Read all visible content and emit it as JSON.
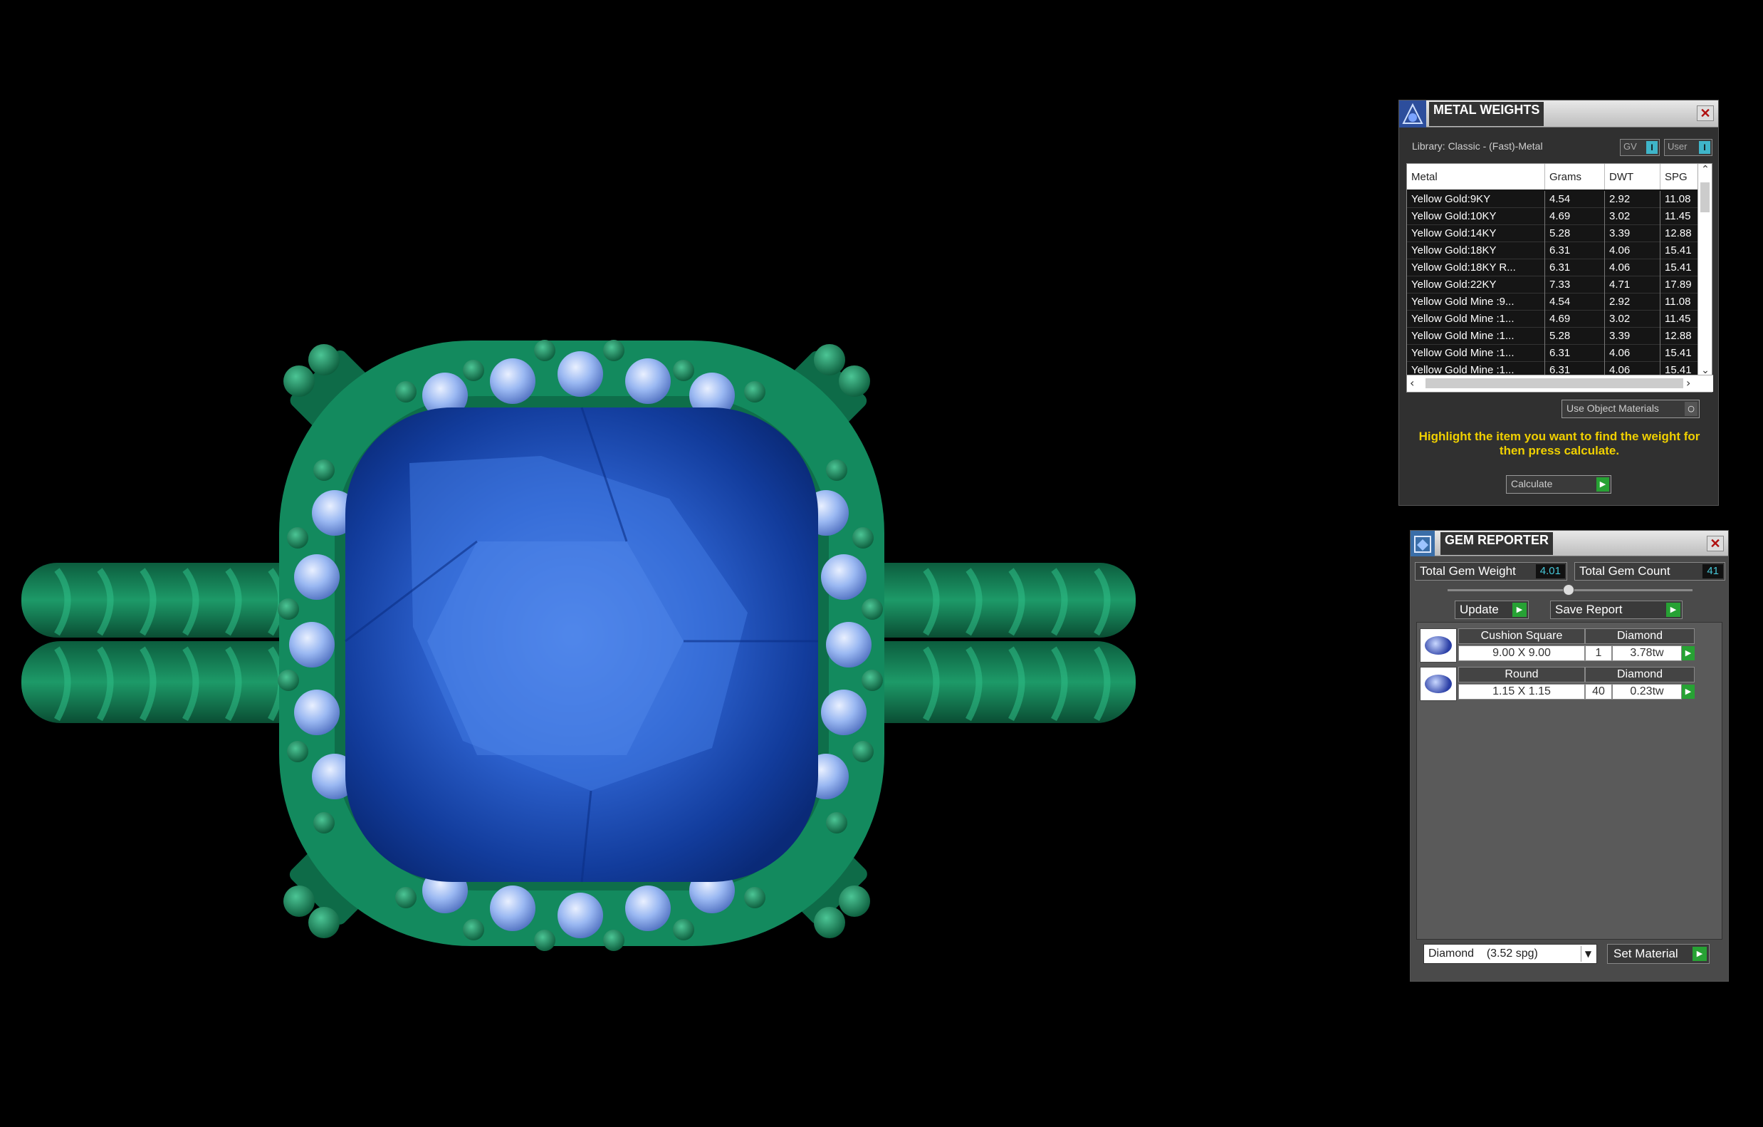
{
  "metal_weights": {
    "title": "METAL WEIGHTS",
    "library": "Library: Classic - (Fast)-Metal",
    "toggle_gv": "GV",
    "toggle_user": "User",
    "toggle_state": "I",
    "columns": [
      "Metal",
      "Grams",
      "DWT",
      "SPG"
    ],
    "rows": [
      [
        "Yellow Gold:9KY",
        "4.54",
        "2.92",
        "11.08"
      ],
      [
        "Yellow Gold:10KY",
        "4.69",
        "3.02",
        "11.45"
      ],
      [
        "Yellow Gold:14KY",
        "5.28",
        "3.39",
        "12.88"
      ],
      [
        "Yellow Gold:18KY",
        "6.31",
        "4.06",
        "15.41"
      ],
      [
        "Yellow Gold:18KY R...",
        "6.31",
        "4.06",
        "15.41"
      ],
      [
        "Yellow Gold:22KY",
        "7.33",
        "4.71",
        "17.89"
      ],
      [
        "Yellow Gold Mine :9...",
        "4.54",
        "2.92",
        "11.08"
      ],
      [
        "Yellow Gold Mine :1...",
        "4.69",
        "3.02",
        "11.45"
      ],
      [
        "Yellow Gold Mine :1...",
        "5.28",
        "3.39",
        "12.88"
      ],
      [
        "Yellow Gold Mine :1...",
        "6.31",
        "4.06",
        "15.41"
      ],
      [
        "Yellow Gold Mine :1...",
        "6.31",
        "4.06",
        "15.41"
      ]
    ],
    "use_object_materials": "Use Object Materials",
    "info": "Highlight the item you want to find the weight for then press calculate.",
    "calculate": "Calculate"
  },
  "gem_reporter": {
    "title": "GEM REPORTER",
    "total_weight_label": "Total Gem Weight",
    "total_weight": "4.01",
    "total_count_label": "Total Gem Count",
    "total_count": "41",
    "update": "Update",
    "save_report": "Save Report",
    "gems": [
      {
        "shape": "Cushion Square",
        "material": "Diamond",
        "size": "9.00 X 9.00",
        "count": "1",
        "weight": "3.78tw"
      },
      {
        "shape": "Round",
        "material": "Diamond",
        "size": "1.15 X 1.15",
        "count": "40",
        "weight": "0.23tw"
      }
    ],
    "material_select": "Diamond    (3.52 spg)",
    "set_material": "Set Material"
  },
  "colors": {
    "background": "#000000",
    "metal_green": "#1a8a5a",
    "center_stone": "#1b4fb0",
    "accent_green": "#27a234",
    "info_yellow": "#f0d000"
  },
  "icons": [
    "metal-weights-logo-icon",
    "gem-reporter-logo-icon",
    "close-icon",
    "go-arrow-icon",
    "dropdown-arrow-icon"
  ]
}
